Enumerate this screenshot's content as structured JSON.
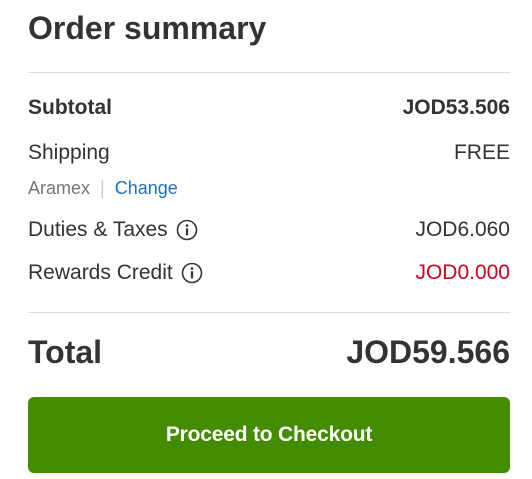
{
  "title": "Order summary",
  "subtotal": {
    "label": "Subtotal",
    "value": "JOD53.506"
  },
  "shipping": {
    "label": "Shipping",
    "value": "FREE",
    "carrier": "Aramex",
    "separator": "|",
    "change_label": "Change"
  },
  "duties": {
    "label": "Duties & Taxes",
    "value": "JOD6.060",
    "icon": "info-icon"
  },
  "rewards": {
    "label": "Rewards Credit",
    "value": "JOD0.000",
    "icon": "info-icon",
    "value_color": "#d0021b"
  },
  "total": {
    "label": "Total",
    "value": "JOD59.566"
  },
  "checkout_button": {
    "label": "Proceed to Checkout",
    "color": "#438c00"
  },
  "link_color": "#1a73c9"
}
